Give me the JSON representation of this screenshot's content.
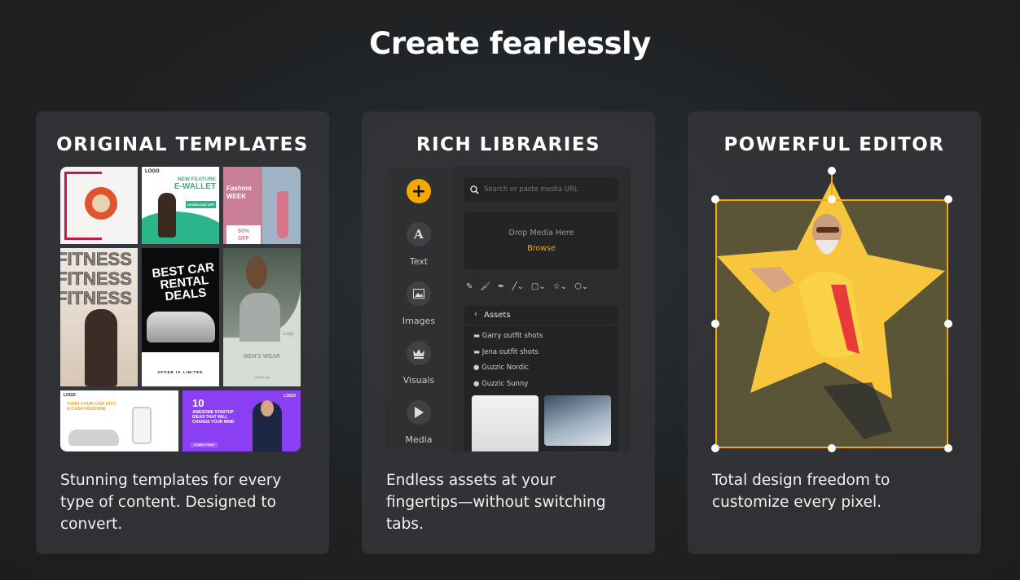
{
  "title": "Create fearlessly",
  "accent": "#f5a800",
  "cards": [
    {
      "heading": "ORIGINAL TEMPLATES",
      "description": "Stunning templates for every type of content. Designed to convert."
    },
    {
      "heading": "RICH LIBRARIES",
      "description": "Endless assets at your fingertips—without switching tabs."
    },
    {
      "heading": "POWERFUL EDITOR",
      "description": "Total design freedom to customize every pixel."
    }
  ],
  "templates": {
    "ewallet": {
      "logo": "LOGO",
      "line1": "NEW FEATURE",
      "line2": "E-WALLET",
      "cta": "DOWNLOAD APP"
    },
    "fashion": {
      "line1": "Fashion",
      "line2": "WEEK",
      "offer1": "50%",
      "offer2": "OFF"
    },
    "fitness": {
      "word": "FITNESS"
    },
    "car": {
      "line1": "BEST CAR",
      "line2": "RENTAL",
      "line3": "DEALS",
      "footer": "OFFER IS LIMITED"
    },
    "menswear": {
      "logo": "Logo",
      "label": "MEN'S WEAR",
      "cta": "Swipe up"
    },
    "cashcar": {
      "logo": "LOGO",
      "line1": "TURN YOUR CAR INTO",
      "line2": "A CASH MACHINE"
    },
    "startup": {
      "logo": "LOGO",
      "number": "10",
      "text": "AWESOME STARTUP IDEAS THAT WILL CHANGE YOUR MIND",
      "cta": "LEARN TODAY"
    }
  },
  "library": {
    "sidebar": [
      {
        "label": "Text",
        "icon": "letter-a-icon"
      },
      {
        "label": "Images",
        "icon": "image-icon"
      },
      {
        "label": "Visuals",
        "icon": "crown-icon"
      },
      {
        "label": "Media",
        "icon": "play-icon"
      }
    ],
    "search_placeholder": "Search or paste media URL",
    "drop_text": "Drop Media Here",
    "browse": "Browse",
    "tools": [
      "pencil-icon",
      "brush-icon",
      "pen-icon",
      "line-icon",
      "rectangle-icon",
      "star-icon",
      "hexagon-icon"
    ],
    "assets_title": "Assets",
    "assets": [
      {
        "label": "Garry outfit shots",
        "icon": "folder-icon"
      },
      {
        "label": "Jena outfit shots",
        "icon": "folder-icon"
      },
      {
        "label": "Guzzic Nordic",
        "icon": "palette-icon"
      },
      {
        "label": "Guzzic Sunny",
        "icon": "palette-icon"
      }
    ]
  }
}
